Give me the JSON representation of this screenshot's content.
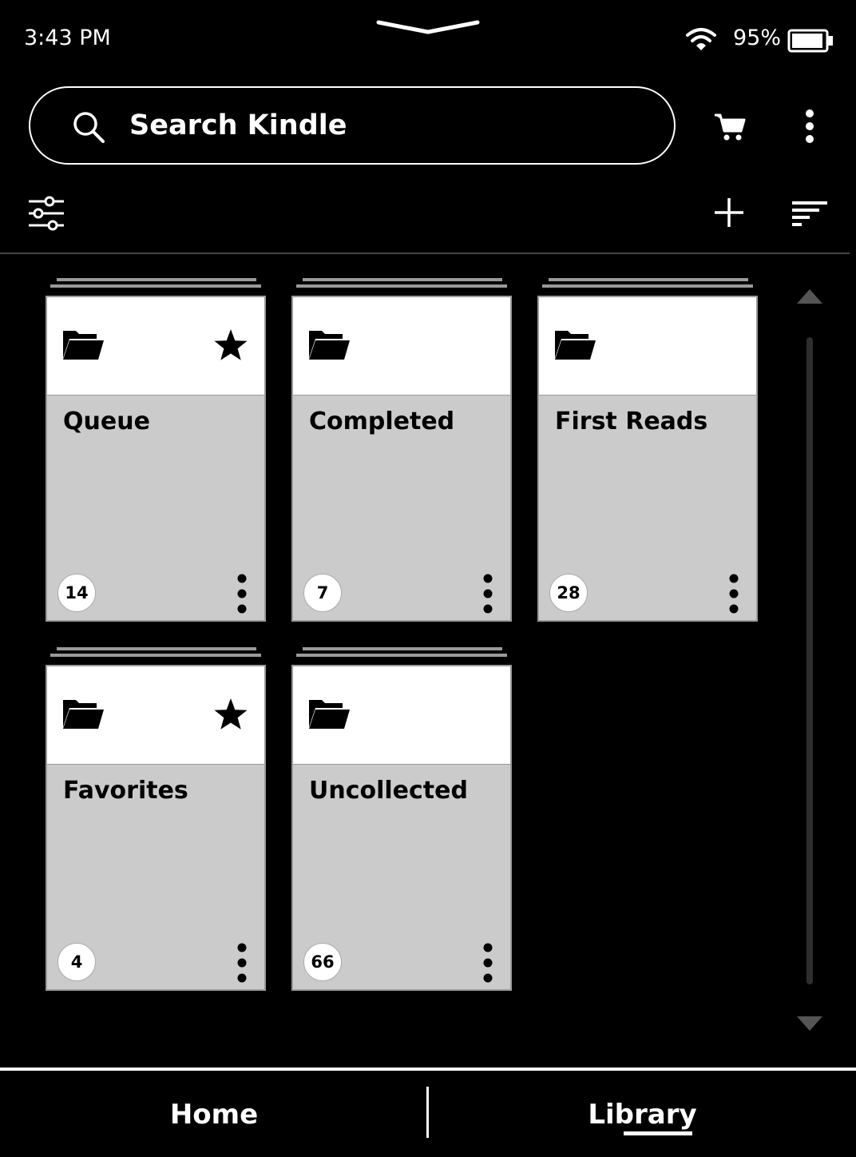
{
  "status_bar": {
    "time": "3:43 PM",
    "battery_percent": "95%",
    "battery_level": 0.95,
    "icons": [
      "pull-down-handle-icon",
      "wifi-icon",
      "battery-icon"
    ]
  },
  "search": {
    "placeholder": "Search Kindle",
    "icon": "search-icon"
  },
  "header_actions": [
    "cart-icon",
    "more-vertical-icon"
  ],
  "toolbar": {
    "icons": [
      "filter-icon",
      "plus-icon",
      "sort-icon"
    ]
  },
  "collections": [
    {
      "title": "Queue",
      "count": "14",
      "favorite": true
    },
    {
      "title": "Completed",
      "count": "7",
      "favorite": false
    },
    {
      "title": "First Reads",
      "count": "28",
      "favorite": false
    },
    {
      "title": "Favorites",
      "count": "4",
      "favorite": true
    },
    {
      "title": "Uncollected",
      "count": "66",
      "favorite": false
    }
  ],
  "bottom_nav": {
    "home": "Home",
    "library": "Library",
    "active": "library"
  },
  "colors": {
    "background": "#000000",
    "card_body": "#cbcbcb",
    "card_head": "#ffffff",
    "text_light": "#ffffff",
    "text_dark": "#000000"
  }
}
